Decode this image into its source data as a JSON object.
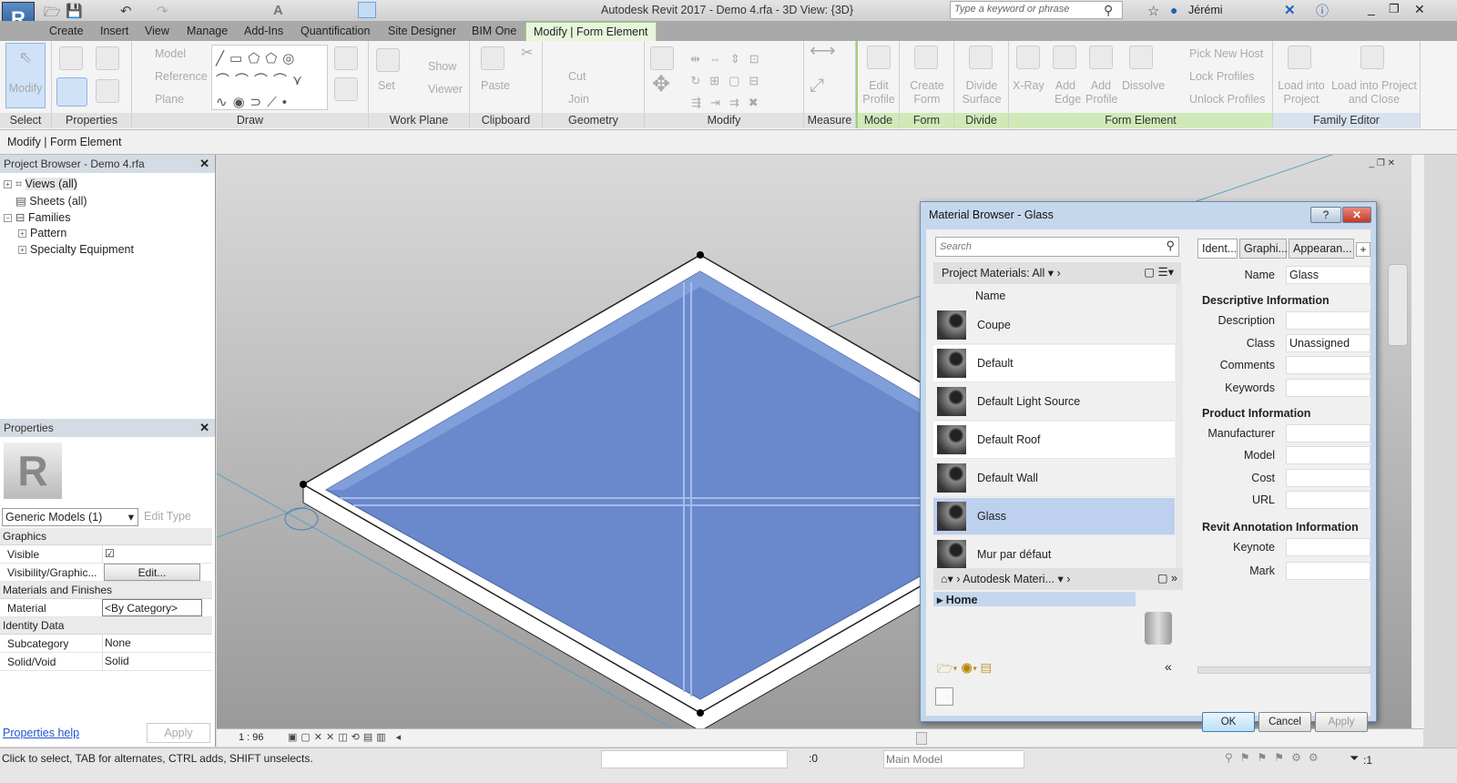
{
  "app": {
    "title": "Autodesk Revit 2017 -     Demo 4.rfa - 3D View: {3D}",
    "search_placeholder": "Type a keyword or phrase",
    "user": "Jérémi",
    "app_button": "R"
  },
  "tabs": [
    "Create",
    "Insert",
    "View",
    "Manage",
    "Add-Ins",
    "Quantification",
    "Site Designer",
    "BIM One",
    "Modify | Form Element"
  ],
  "ribbon": {
    "panels": [
      "Select",
      "Properties",
      "Draw",
      "Work Plane",
      "Clipboard",
      "Geometry",
      "Modify",
      "Measure",
      "Mode",
      "Form",
      "Divide",
      "Form Element",
      "Family Editor"
    ],
    "modify": "Modify",
    "draw_model": "Model",
    "draw_reference": "Reference",
    "draw_plane": "Plane",
    "wp_set": "Set",
    "wp_show": "Show",
    "wp_viewer": "Viewer",
    "paste": "Paste",
    "cut": "Cut",
    "join": "Join",
    "edit_profile": "Edit Profile",
    "create_form": "Create Form",
    "divide_surface": "Divide Surface",
    "xray": "X-Ray",
    "add_edge": "Add Edge",
    "add_profile": "Add Profile",
    "dissolve": "Dissolve",
    "pick_new_host": "Pick  New Host",
    "lock_profiles": "Lock  Profiles",
    "unlock_profiles": "Unlock  Profiles",
    "load_project": "Load into Project",
    "load_close": "Load into Project and Close"
  },
  "context_bar": "Modify | Form Element",
  "project_browser": {
    "title": "Project Browser - Demo 4.rfa",
    "items": [
      "Views (all)",
      "Sheets (all)",
      "Families",
      "Pattern",
      "Specialty Equipment"
    ]
  },
  "properties": {
    "title": "Properties",
    "type": "Generic Models (1)",
    "edit_type": "Edit Type",
    "groups": [
      "Graphics",
      "Materials and Finishes",
      "Identity Data"
    ],
    "rows": [
      {
        "k": "Visible",
        "v": "☑"
      },
      {
        "k": "Visibility/Graphic...",
        "v": "Edit..."
      },
      {
        "k": "Material",
        "v": "<By Category>"
      },
      {
        "k": "Subcategory",
        "v": "None"
      },
      {
        "k": "Solid/Void",
        "v": "Solid"
      }
    ],
    "help": "Properties help",
    "apply": "Apply"
  },
  "view_bar": {
    "scale": "1 : 96"
  },
  "status": {
    "hint": "Click to select, TAB for alternates, CTRL adds, SHIFT unselects.",
    "workset": ":0",
    "model": "Main Model",
    "filter": ":1"
  },
  "material_browser": {
    "title": "Material Browser - Glass",
    "search_placeholder": "Search",
    "filter": "Project Materials: All",
    "col_name": "Name",
    "materials": [
      "Coupe",
      "Default",
      "Default Light Source",
      "Default Roof",
      "Default Wall",
      "Glass",
      "Mur par défaut"
    ],
    "selected": "Glass",
    "library": "Autodesk Materi...",
    "home": "Home",
    "tabs": [
      "Ident...",
      "Graphi...",
      "Appearan..."
    ],
    "name_label": "Name",
    "name_value": "Glass",
    "sections": [
      "Descriptive Information",
      "Product Information",
      "Revit Annotation Information"
    ],
    "desc_fields": [
      {
        "k": "Description",
        "v": ""
      },
      {
        "k": "Class",
        "v": "Unassigned"
      },
      {
        "k": "Comments",
        "v": ""
      },
      {
        "k": "Keywords",
        "v": ""
      }
    ],
    "prod_fields": [
      {
        "k": "Manufacturer",
        "v": ""
      },
      {
        "k": "Model",
        "v": ""
      },
      {
        "k": "Cost",
        "v": ""
      },
      {
        "k": "URL",
        "v": ""
      }
    ],
    "annot_fields": [
      {
        "k": "Keynote",
        "v": ""
      },
      {
        "k": "Mark",
        "v": ""
      }
    ],
    "ok": "OK",
    "cancel": "Cancel",
    "apply": "Apply",
    "help": "?"
  }
}
